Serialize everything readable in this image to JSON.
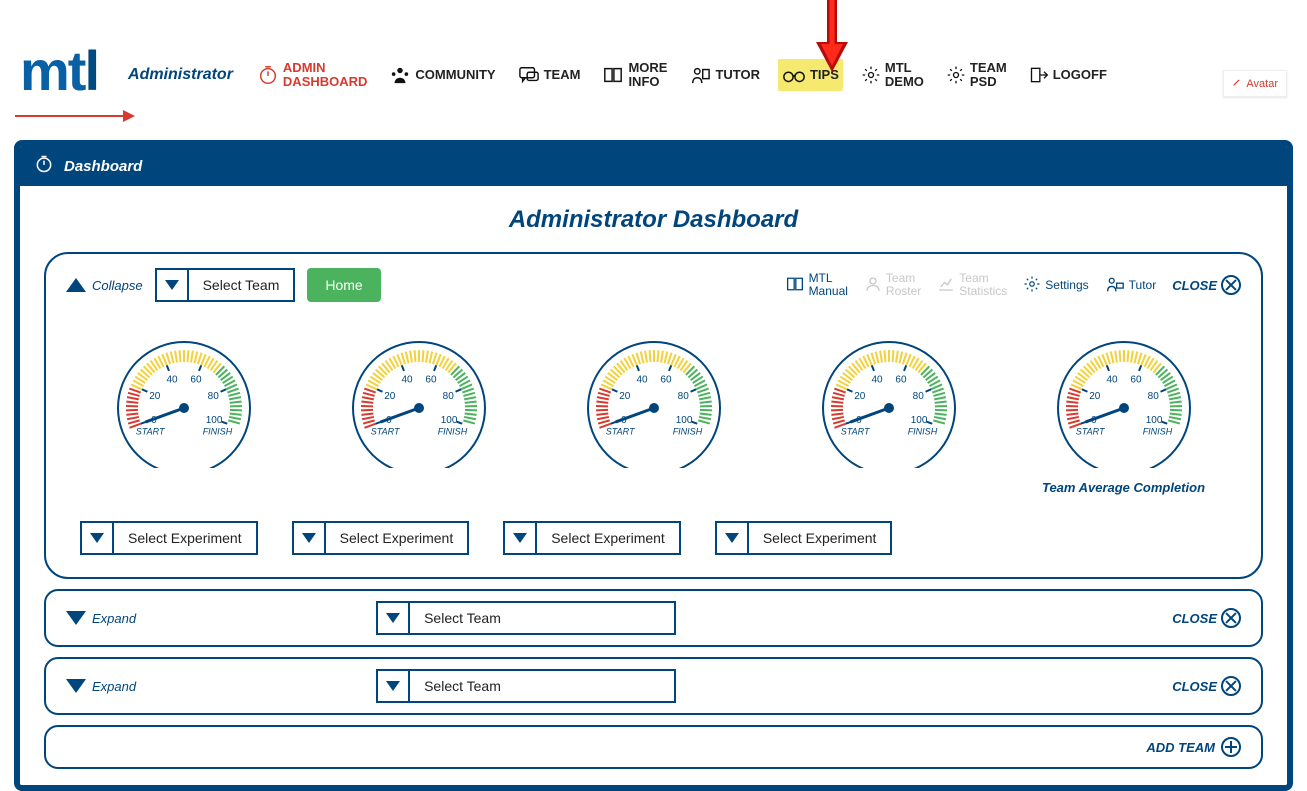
{
  "role_label": "Administrator",
  "avatar_label": "Avatar",
  "nav": {
    "admin": {
      "line1": "ADMIN",
      "line2": "DASHBOARD"
    },
    "community": "COMMUNITY",
    "team": "TEAM",
    "more_info": {
      "line1": "MORE",
      "line2": "INFO"
    },
    "tutor": "TUTOR",
    "tips": "TIPS",
    "mtl_demo": {
      "line1": "MTL",
      "line2": "DEMO"
    },
    "team_psd": {
      "line1": "TEAM",
      "line2": "PSD"
    },
    "logoff": "LOGOFF"
  },
  "dashboard": {
    "header": "Dashboard",
    "title": "Administrator Dashboard",
    "collapse_label": "Collapse",
    "expand_label": "Expand",
    "select_team_label": "Select Team",
    "home_label": "Home",
    "close_label": "CLOSE",
    "add_team_label": "ADD TEAM",
    "select_experiment_label": "Select Experiment",
    "gauge_avg_caption": "Team Average Completion",
    "tools": {
      "manual": {
        "line1": "MTL",
        "line2": "Manual"
      },
      "roster": {
        "line1": "Team",
        "line2": "Roster"
      },
      "stats": {
        "line1": "Team",
        "line2": "Statistics"
      },
      "settings": "Settings",
      "tutor": "Tutor"
    }
  },
  "chart_data": {
    "type": "gauge",
    "count": 5,
    "scale": {
      "min": 0,
      "max": 100,
      "ticks": [
        0,
        20,
        40,
        60,
        80,
        100
      ]
    },
    "arc": {
      "start_label": "START",
      "end_label": "FINISH"
    },
    "zones": [
      {
        "from": 0,
        "to": 20,
        "color": "#d83a2f"
      },
      {
        "from": 20,
        "to": 70,
        "color": "#f3d13c"
      },
      {
        "from": 70,
        "to": 100,
        "color": "#4bb35e"
      }
    ],
    "values": [
      0,
      0,
      0,
      0,
      0
    ],
    "last_gauge_caption": "Team Average Completion"
  }
}
